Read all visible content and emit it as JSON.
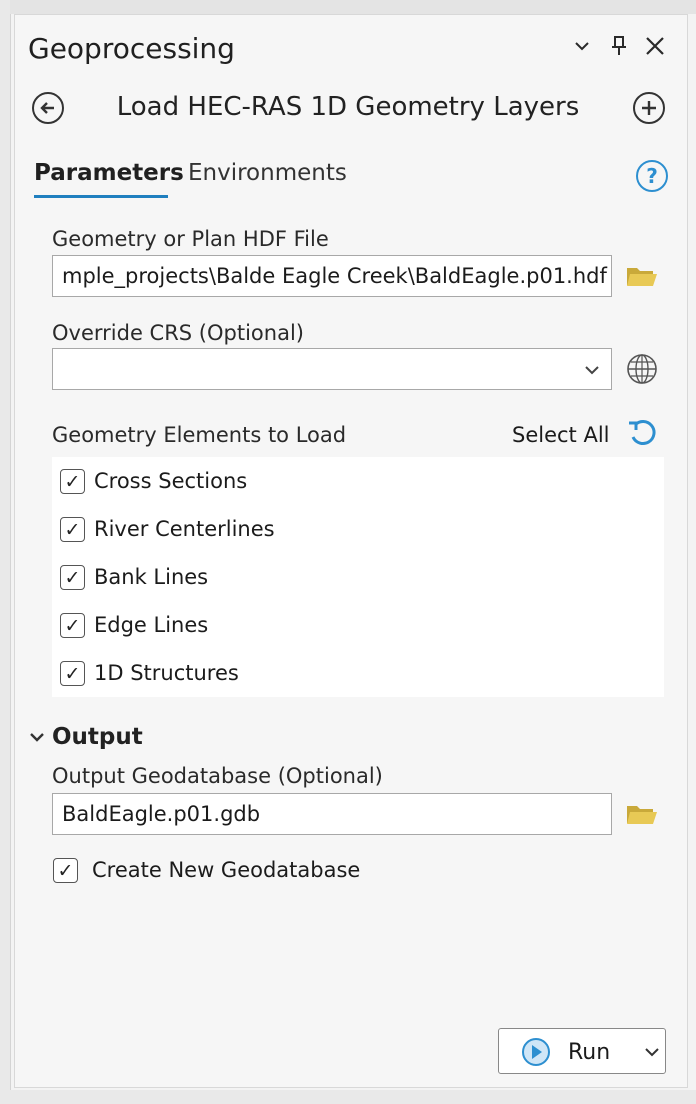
{
  "panel": {
    "title": "Geoprocessing",
    "controls": {
      "options_icon": "chevron-down-icon",
      "pin_icon": "pin-icon",
      "close_icon": "close-icon"
    }
  },
  "tool": {
    "title": "Load HEC-RAS 1D Geometry Layers",
    "back_icon": "back-arrow-icon",
    "add_icon": "add-icon"
  },
  "tabs": [
    {
      "label": "Parameters",
      "active": true
    },
    {
      "label": "Environments",
      "active": false
    }
  ],
  "help_icon": "help-icon",
  "params": {
    "geometry_file": {
      "label": "Geometry or Plan HDF File",
      "value": "mple_projects\\Balde Eagle Creek\\BaldEagle.p01.hdf"
    },
    "override_crs": {
      "label": "Override CRS (Optional)",
      "value": ""
    },
    "elements": {
      "label": "Geometry Elements to Load",
      "select_all": "Select All",
      "items": [
        {
          "label": "Cross Sections",
          "checked": true
        },
        {
          "label": "River Centerlines",
          "checked": true
        },
        {
          "label": "Bank Lines",
          "checked": true
        },
        {
          "label": "Edge Lines",
          "checked": true
        },
        {
          "label": "1D Structures",
          "checked": true
        }
      ]
    }
  },
  "output": {
    "section_label": "Output",
    "geodatabase": {
      "label": "Output Geodatabase (Optional)",
      "value": "BaldEagle.p01.gdb"
    },
    "create_new": {
      "label": "Create New Geodatabase",
      "checked": true
    }
  },
  "run": {
    "label": "Run"
  },
  "colors": {
    "accent": "#1f7fbf",
    "folder": "#e2c04a",
    "help": "#2d8fd0"
  }
}
